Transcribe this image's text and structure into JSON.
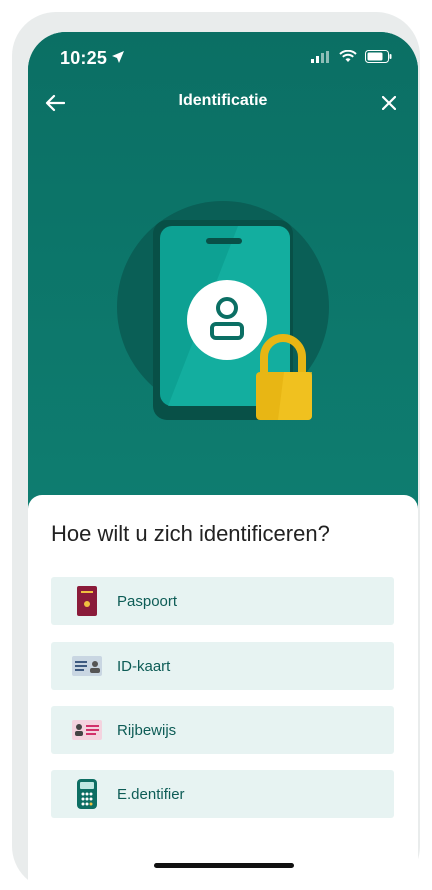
{
  "status_bar": {
    "time": "10:25"
  },
  "header": {
    "title": "Identificatie"
  },
  "question": "Hoe wilt u zich identificeren?",
  "options": [
    {
      "label": "Paspoort",
      "icon": "passport-icon"
    },
    {
      "label": "ID-kaart",
      "icon": "id-card-icon"
    },
    {
      "label": "Rijbewijs",
      "icon": "drivers-license-icon"
    },
    {
      "label": "E.dentifier",
      "icon": "edentifier-icon"
    }
  ],
  "colors": {
    "header_bg": "#0e7a6e",
    "option_bg": "#e7f3f2",
    "lock": "#e8b614"
  }
}
